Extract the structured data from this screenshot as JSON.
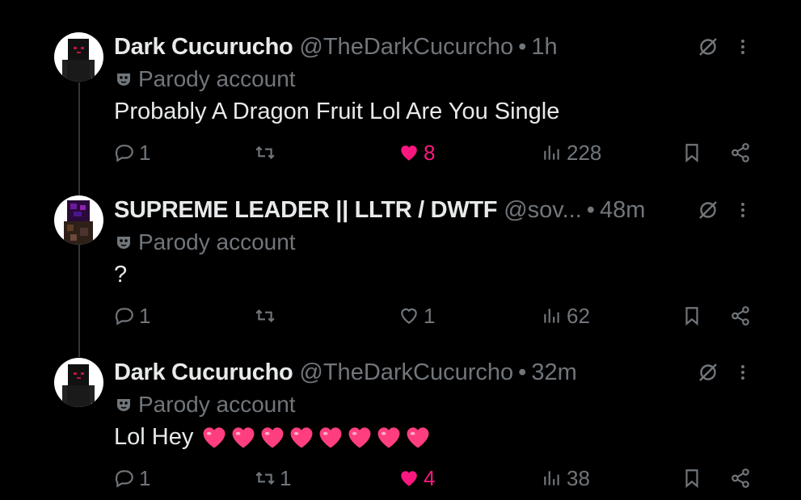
{
  "colors": {
    "background": "#000000",
    "text": "#e7e9ea",
    "muted": "#71767b",
    "like_active": "#f91880",
    "heart_emoji": "#ff3e7f"
  },
  "tweets": [
    {
      "name": "Dark Cucurucho",
      "handle": "@TheDarkCucurcho",
      "separator": "•",
      "time": "1h",
      "parody": "Parody account",
      "text": "Probably A Dragon Fruit Lol Are You Single",
      "replies": "1",
      "reposts": "",
      "likes": "8",
      "liked": true,
      "views": "228"
    },
    {
      "name": "SUPREME LEADER || LLTR / DWTF",
      "handle": "@sov...",
      "separator": "•",
      "time": "48m",
      "parody": "Parody account",
      "text": "?",
      "replies": "1",
      "reposts": "",
      "likes": "1",
      "liked": false,
      "views": "62"
    },
    {
      "name": "Dark Cucurucho",
      "handle": "@TheDarkCucurcho",
      "separator": "•",
      "time": "32m",
      "parody": "Parody account",
      "text": "Lol Hey",
      "heart_emoji_count": 8,
      "replies": "1",
      "reposts": "1",
      "likes": "4",
      "liked": true,
      "views": "38"
    }
  ]
}
